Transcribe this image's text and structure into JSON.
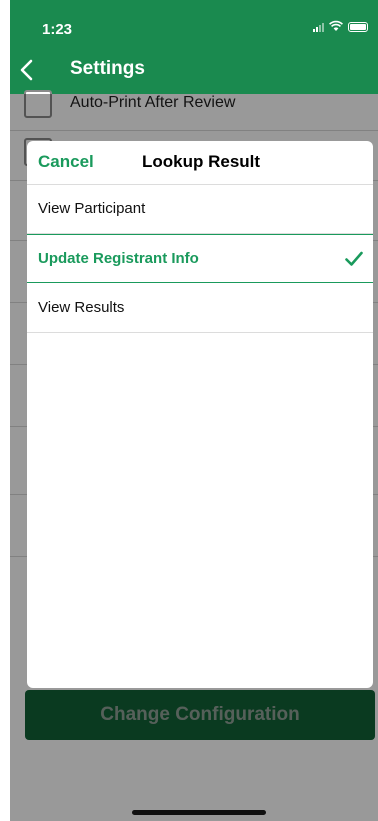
{
  "status_bar": {
    "time": "1:23"
  },
  "nav": {
    "title": "Settings"
  },
  "background": {
    "first_row_label": "Auto-Print After Review",
    "primary_button_label": "Change Configuration"
  },
  "modal": {
    "cancel_label": "Cancel",
    "title": "Lookup Result",
    "options": [
      {
        "label": "View Participant",
        "selected": false
      },
      {
        "label": "Update Registrant Info",
        "selected": true
      },
      {
        "label": "View Results",
        "selected": false
      }
    ]
  },
  "colors": {
    "brand_green": "#1a8a4f",
    "accent_green": "#1a9a5c"
  }
}
